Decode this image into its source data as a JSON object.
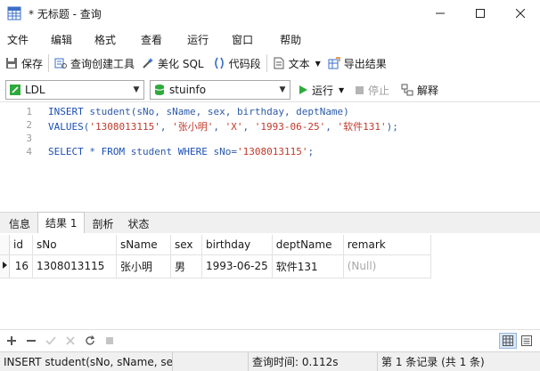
{
  "window": {
    "title": "* 无标题 - 查询",
    "controls": [
      "minimize",
      "maximize",
      "close"
    ]
  },
  "menu": [
    "文件",
    "编辑",
    "格式",
    "查看",
    "运行",
    "窗口",
    "帮助"
  ],
  "toolbar": {
    "save": "保存",
    "query_builder": "查询创建工具",
    "beautify": "美化 SQL",
    "snippet": "代码段",
    "text": "文本",
    "export": "导出结果"
  },
  "selectors": {
    "connection": "LDL",
    "database": "stuinfo",
    "run": "运行",
    "stop": "停止",
    "explain": "解释"
  },
  "editor": {
    "line_numbers": [
      "1",
      "2",
      "3",
      "4"
    ],
    "lines": [
      "INSERT student(sNo, sName, sex, birthday, deptName)",
      "VALUES('1308013115', '张小明', 'X', '1993-06-25', '软件131');",
      "",
      "SELECT * FROM student WHERE sNo='1308013115';"
    ]
  },
  "result_tabs": [
    "信息",
    "结果 1",
    "剖析",
    "状态"
  ],
  "active_result_tab": "结果 1",
  "grid": {
    "columns": [
      "id",
      "sNo",
      "sName",
      "sex",
      "birthday",
      "deptName",
      "remark"
    ],
    "rows": [
      [
        "16",
        "1308013115",
        "张小明",
        "男",
        "1993-06-25",
        "软件131",
        "(Null)"
      ]
    ]
  },
  "status": {
    "sql": "INSERT student(sNo, sName, sex",
    "query_time": "查询时间: 0.112s",
    "record": "第 1 条记录 (共 1 条)"
  },
  "colors": {
    "accent_green": "#2eaa3c",
    "keyword_blue": "#1b4fb5",
    "string_red": "#c0392b"
  }
}
